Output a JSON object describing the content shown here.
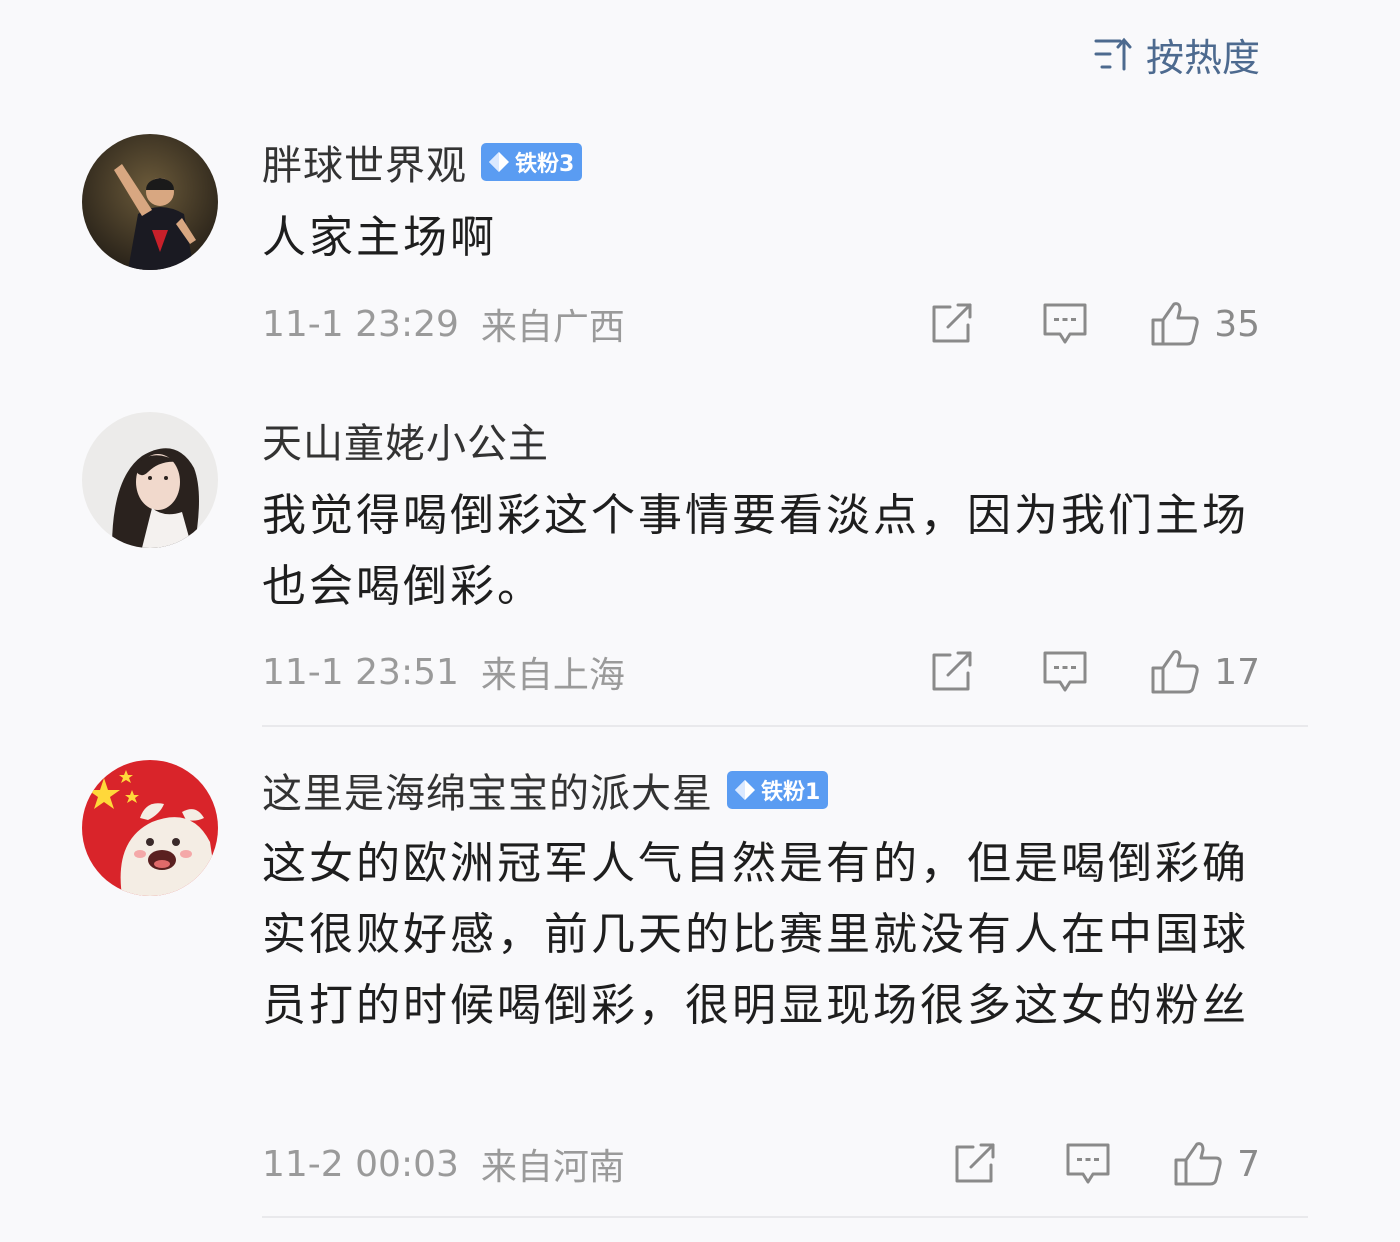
{
  "sort": {
    "label": "按热度",
    "icon": "sort-icon"
  },
  "comments": [
    {
      "username": "胖球世界观",
      "badge": "铁粉3",
      "text": "人家主场啊",
      "time": "11-1 23:29",
      "location": "来自广西",
      "likes": "35",
      "avatar": "avatar-athlete"
    },
    {
      "username": "天山童姥小公主",
      "badge": "",
      "text": "我觉得喝倒彩这个事情要看淡点，因为我们主场也会喝倒彩。",
      "time": "11-1 23:51",
      "location": "来自上海",
      "likes": "17",
      "avatar": "avatar-woman"
    },
    {
      "username": "这里是海绵宝宝的派大星",
      "badge": "铁粉1",
      "text": "这女的欧洲冠军人气自然是有的，但是喝倒彩确实很败好感，前几天的比赛里就没有人在中国球员打的时候喝倒彩，很明显现场很多这女的粉丝",
      "time": "11-2 00:03",
      "location": "来自河南",
      "likes": "7",
      "avatar": "avatar-cartoon-flag"
    }
  ],
  "icons": {
    "share": "share-icon",
    "reply": "reply-icon",
    "like": "thumbs-up-icon",
    "badge": "diamond-icon"
  },
  "colors": {
    "background": "#f9f9fb",
    "sort_accent": "#4d6a8f",
    "badge_blue": "#5a9cf2",
    "meta_gray": "#9a9a9a",
    "text_dark": "#1e1e1e"
  }
}
